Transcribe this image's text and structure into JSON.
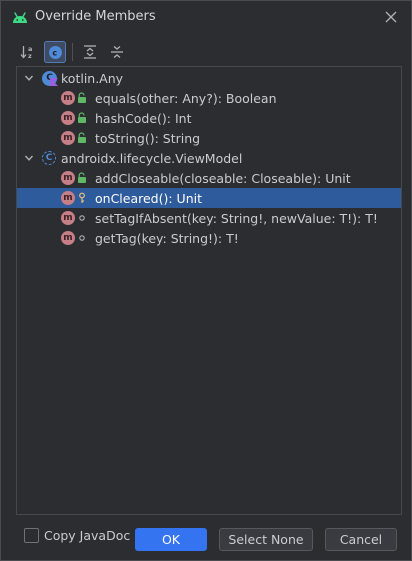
{
  "window": {
    "title": "Override Members",
    "close_icon": "close-icon",
    "app_icon": "android-icon"
  },
  "toolbar": {
    "buttons": [
      {
        "icon": "sort-alphabetically-icon",
        "active": false
      },
      {
        "icon": "group-by-class-icon",
        "active": true
      },
      {
        "icon": "expand-all-icon",
        "active": false
      },
      {
        "icon": "collapse-all-icon",
        "active": false
      }
    ]
  },
  "tree": {
    "groups": [
      {
        "name": "kotlin.Any",
        "icon": "kotlin-class-icon",
        "members": [
          {
            "label": "equals(other: Any?): Boolean",
            "visibility": "public",
            "selected": false
          },
          {
            "label": "hashCode(): Int",
            "visibility": "public",
            "selected": false
          },
          {
            "label": "toString(): String",
            "visibility": "public",
            "selected": false
          }
        ]
      },
      {
        "name": "androidx.lifecycle.ViewModel",
        "icon": "abstract-class-icon",
        "members": [
          {
            "label": "addCloseable(closeable: Closeable): Unit",
            "visibility": "public",
            "selected": false
          },
          {
            "label": "onCleared(): Unit",
            "visibility": "protected",
            "selected": true
          },
          {
            "label": "setTagIfAbsent(key: String!, newValue: T!): T!",
            "visibility": "package",
            "selected": false
          },
          {
            "label": "getTag(key: String!): T!",
            "visibility": "package",
            "selected": false
          }
        ]
      }
    ]
  },
  "footer": {
    "copy_javadoc_label": "Copy JavaDoc",
    "copy_javadoc_checked": false,
    "ok_label": "OK",
    "select_none_label": "Select None",
    "cancel_label": "Cancel"
  },
  "colors": {
    "accent": "#3574f0",
    "selection": "#2e5b9c",
    "method_icon": "#c67f86",
    "public_lock": "#5fb865",
    "android_green": "#3ddc84"
  }
}
